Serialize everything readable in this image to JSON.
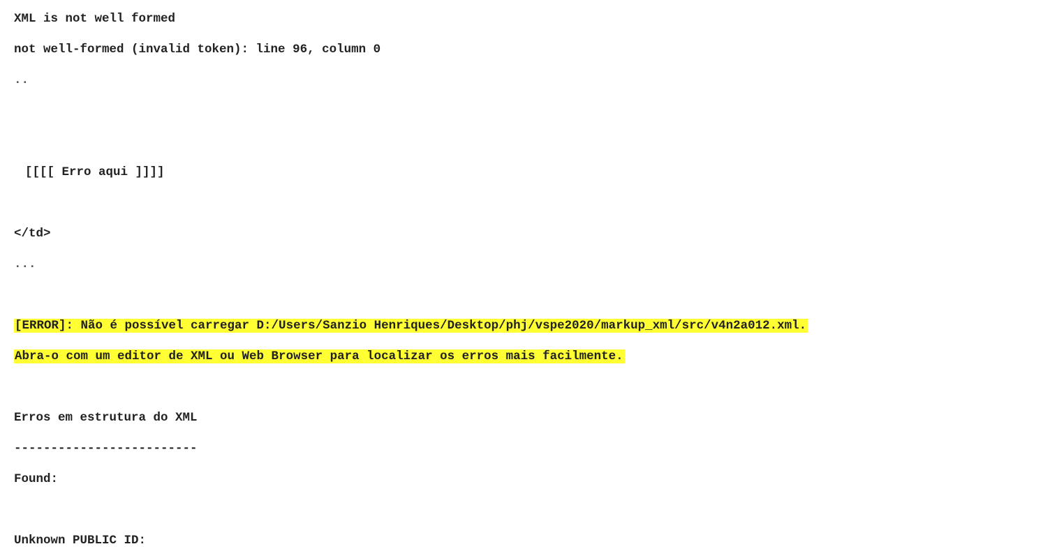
{
  "title": "XML is not well formed",
  "parse_error": "not well-formed (invalid token): line 96, column 0",
  "ellipsis_short": "..",
  "error_marker": "[[[[ Erro aqui ]]]]",
  "closing_tag": "</td>",
  "ellipsis_long": "...",
  "error_message_line1": "[ERROR]: Não é possível carregar D:/Users/Sanzio Henriques/Desktop/phj/vspe2020/markup_xml/src/v4n2a012.xml.",
  "error_message_line2": "Abra-o com um editor de XML ou Web Browser para localizar os erros mais facilmente.",
  "section_heading": "Erros em estrutura do XML",
  "separator": "-------------------------",
  "found_label": "Found:",
  "unknown_public_id_label": "Unknown PUBLIC ID:",
  "colors": {
    "highlight": "#ffff33",
    "text": "#222222",
    "background": "#ffffff"
  }
}
